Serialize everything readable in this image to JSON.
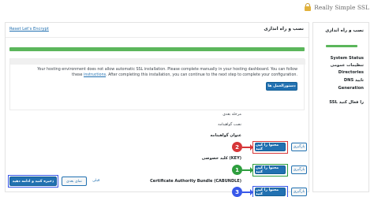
{
  "header": {
    "brand": "Really Simple SSL"
  },
  "panel": {
    "title": "نصب و راه اندازی",
    "reset_link": "Reset Let's Encrypt",
    "progress": 1.0,
    "notice": {
      "text_before": "Your hosting environment does not allow automatic SSL installation. Please complete manually in your hosting dashboard. You can follow these ",
      "link": "instructions",
      "text_after": ". After completing this installation, you can continue to the next step to complete your configuration.",
      "button": "دستورالعمل ها"
    },
    "step_label": "مرحله بعدی",
    "step_sub": "نصب گواهینامه",
    "fields": [
      {
        "label": "عنوان گواهینامه",
        "copy_button": "محتوا را کپی کنید",
        "download_button": "بارگیری",
        "badge": "2",
        "badge_color": "#d63638"
      },
      {
        "label": "کلید خصوصی (KEY)",
        "copy_button": "محتوا را کپی کنید",
        "download_button": "بارگیری",
        "badge": "1",
        "badge_color": "#2e9e3e"
      },
      {
        "label": "Certificate Authority Bundle (CABUNDLE)",
        "copy_button": "محتوا را کپی کنید",
        "download_button": "بارگیری",
        "badge": "3",
        "badge_color": "#3858e9"
      }
    ],
    "footer": {
      "primary_button": "ذخیره کنید و ادامه دهید",
      "secondary_button": "نمای بعدی",
      "link": "قبلی"
    }
  },
  "sidebar": {
    "title": "نصب و راه اندازی",
    "items": [
      {
        "label": "System Status"
      },
      {
        "label": "تنظیمات عمومی"
      },
      {
        "label": "Directories"
      },
      {
        "label": "DNS تایید"
      },
      {
        "label": "Generation"
      },
      {
        "label": "SSL را فعال کنید"
      }
    ]
  }
}
